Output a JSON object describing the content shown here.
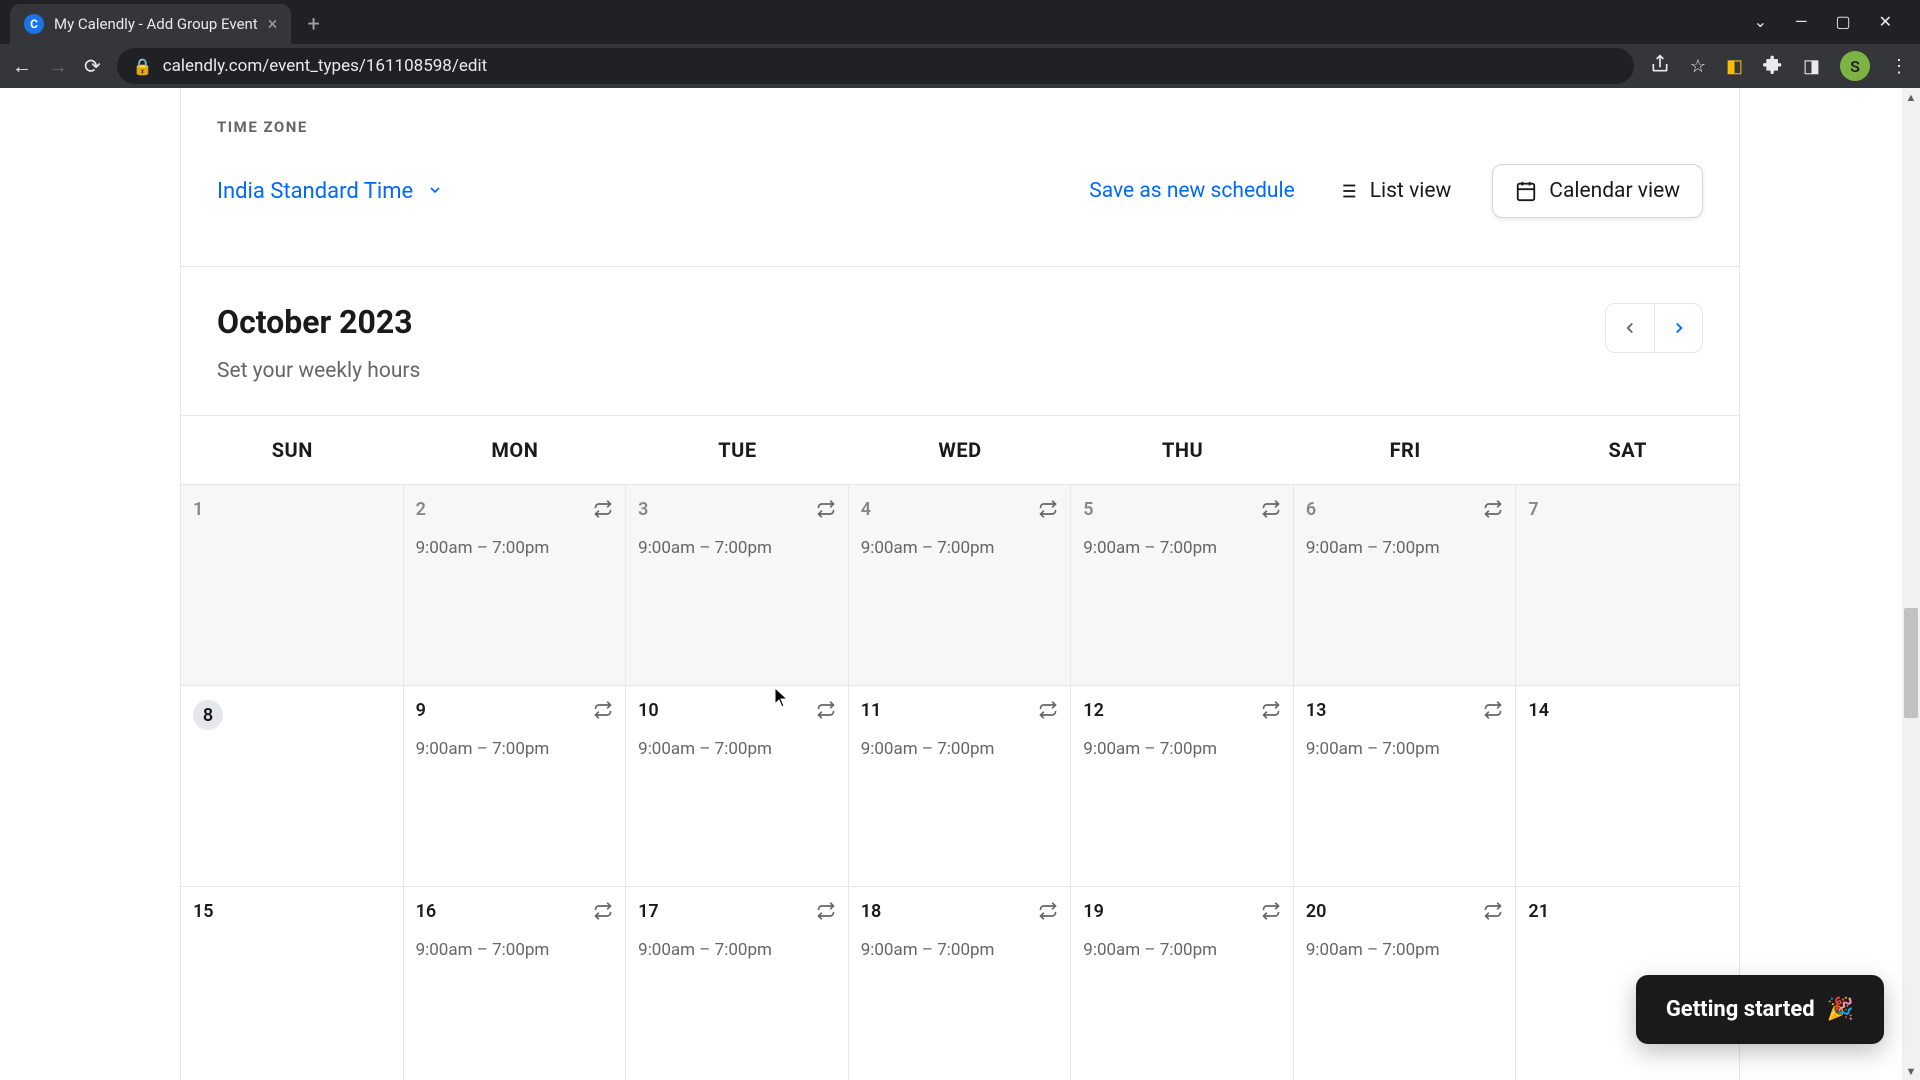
{
  "browser": {
    "tab_title": "My Calendly - Add Group Event",
    "url": "calendly.com/event_types/161108598/edit",
    "avatar_initial": "S"
  },
  "timezone": {
    "label": "TIME ZONE",
    "value": "India Standard Time"
  },
  "actions": {
    "save_schedule": "Save as new schedule",
    "list_view": "List view",
    "calendar_view": "Calendar view"
  },
  "calendar": {
    "month": "October 2023",
    "subtitle": "Set your weekly hours",
    "day_headers": [
      "SUN",
      "MON",
      "TUE",
      "WED",
      "THU",
      "FRI",
      "SAT"
    ],
    "hours_text": "9:00am – 7:00pm",
    "weeks": [
      {
        "past": true,
        "days": [
          {
            "n": "1",
            "hours": false,
            "repeat": false
          },
          {
            "n": "2",
            "hours": true,
            "repeat": true
          },
          {
            "n": "3",
            "hours": true,
            "repeat": true
          },
          {
            "n": "4",
            "hours": true,
            "repeat": true
          },
          {
            "n": "5",
            "hours": true,
            "repeat": true
          },
          {
            "n": "6",
            "hours": true,
            "repeat": true
          },
          {
            "n": "7",
            "hours": false,
            "repeat": false
          }
        ]
      },
      {
        "past": false,
        "days": [
          {
            "n": "8",
            "hours": false,
            "repeat": false,
            "today": true
          },
          {
            "n": "9",
            "hours": true,
            "repeat": true
          },
          {
            "n": "10",
            "hours": true,
            "repeat": true
          },
          {
            "n": "11",
            "hours": true,
            "repeat": true
          },
          {
            "n": "12",
            "hours": true,
            "repeat": true
          },
          {
            "n": "13",
            "hours": true,
            "repeat": true
          },
          {
            "n": "14",
            "hours": false,
            "repeat": false
          }
        ]
      },
      {
        "past": false,
        "days": [
          {
            "n": "15",
            "hours": false,
            "repeat": false
          },
          {
            "n": "16",
            "hours": true,
            "repeat": true
          },
          {
            "n": "17",
            "hours": true,
            "repeat": true
          },
          {
            "n": "18",
            "hours": true,
            "repeat": true
          },
          {
            "n": "19",
            "hours": true,
            "repeat": true
          },
          {
            "n": "20",
            "hours": true,
            "repeat": true
          },
          {
            "n": "21",
            "hours": false,
            "repeat": false
          }
        ]
      }
    ]
  },
  "getting_started": "Getting started"
}
